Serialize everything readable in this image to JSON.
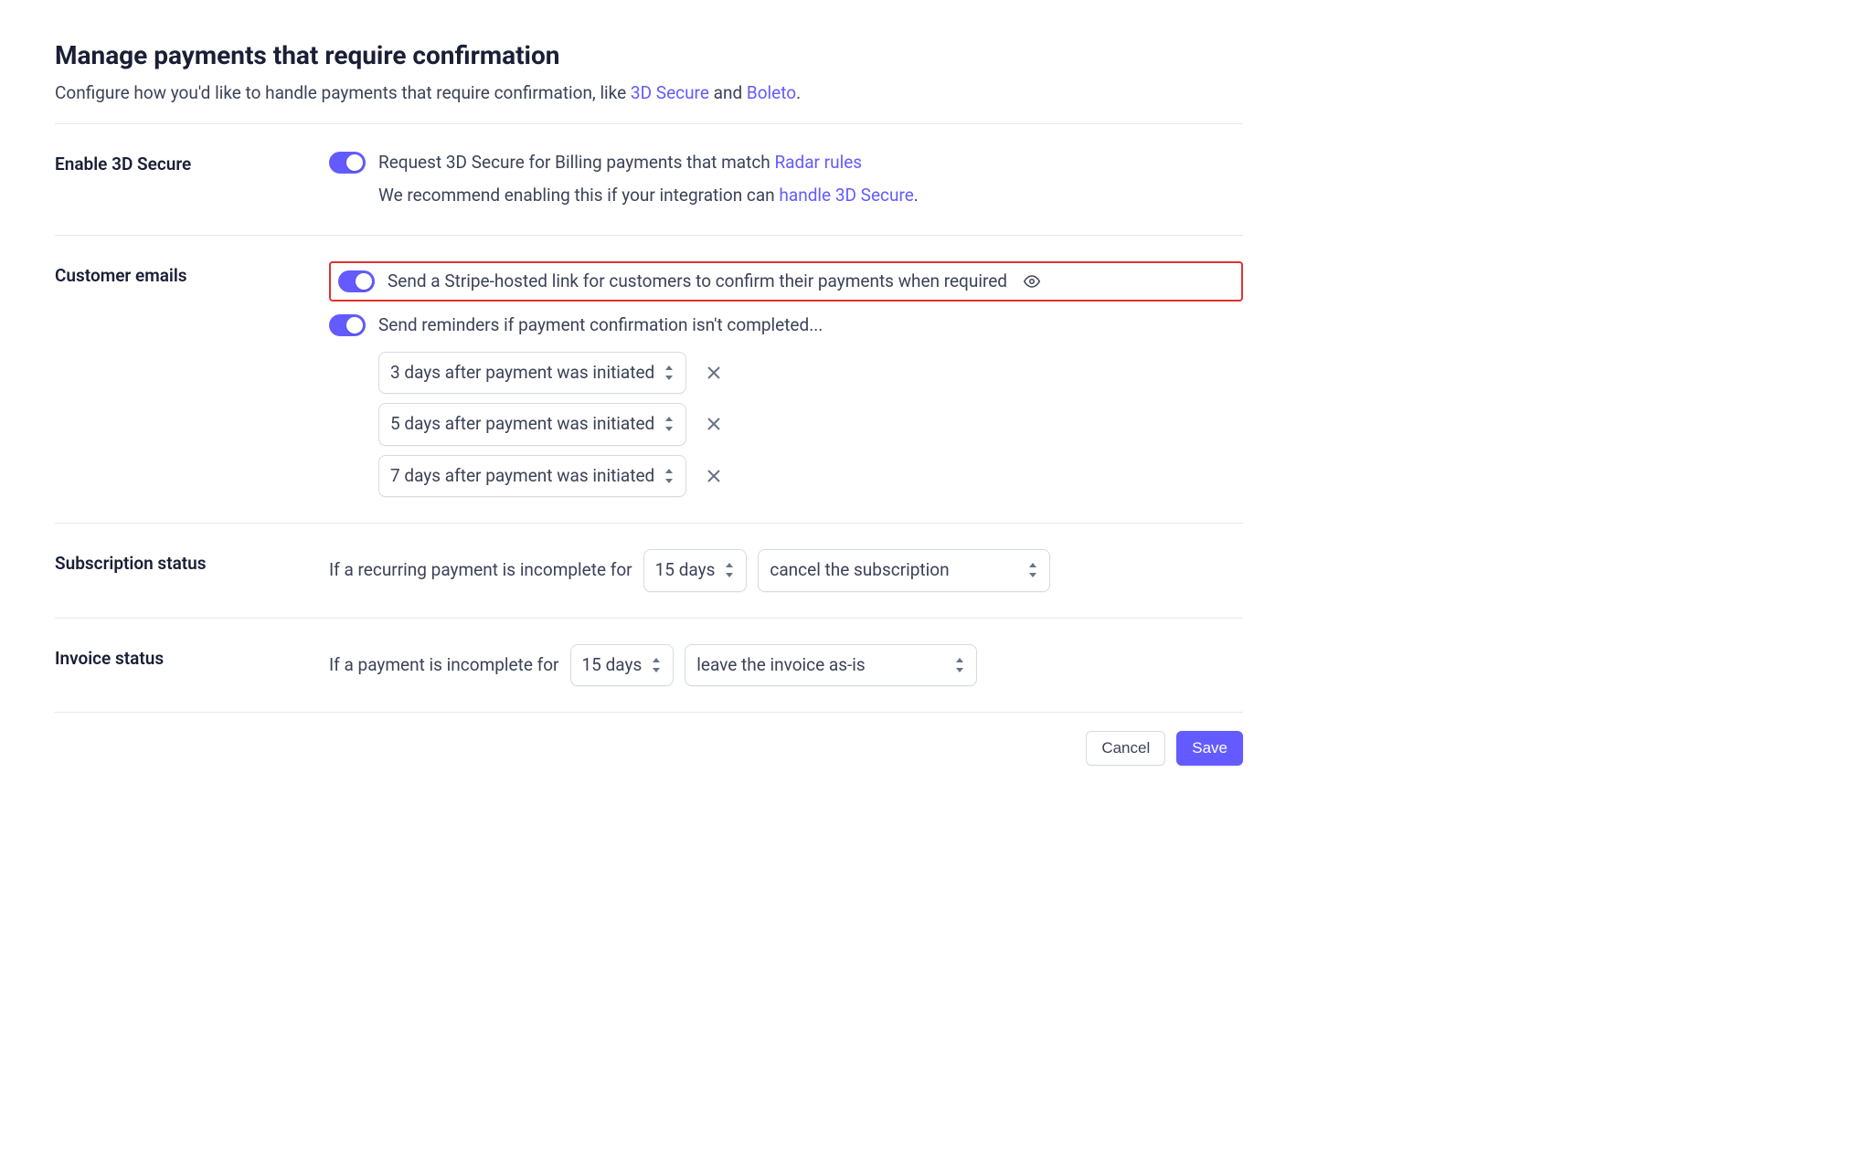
{
  "header": {
    "title": "Manage payments that require confirmation",
    "subtitle_prefix": "Configure how you'd like to handle payments that require confirmation, like ",
    "link1": "3D Secure",
    "mid": " and ",
    "link2": "Boleto",
    "suffix": "."
  },
  "enable3ds": {
    "label": "Enable 3D Secure",
    "line1_prefix": "Request 3D Secure for Billing payments that match ",
    "line1_link": "Radar rules",
    "line2_prefix": "We recommend enabling this if your integration can ",
    "line2_link": "handle 3D Secure",
    "line2_suffix": "."
  },
  "emails": {
    "label": "Customer emails",
    "opt1": "Send a Stripe-hosted link for customers to confirm their payments when required",
    "opt2": "Send reminders if payment confirmation isn't completed...",
    "reminders": [
      "3 days after payment was initiated",
      "5 days after payment was initiated",
      "7 days after payment was initiated"
    ]
  },
  "subscription": {
    "label": "Subscription status",
    "prefix": "If a recurring payment is incomplete for",
    "duration": "15 days",
    "action": "cancel the subscription"
  },
  "invoice": {
    "label": "Invoice status",
    "prefix": "If a payment is incomplete for",
    "duration": "15 days",
    "action": "leave the invoice as-is"
  },
  "footer": {
    "cancel": "Cancel",
    "save": "Save"
  }
}
